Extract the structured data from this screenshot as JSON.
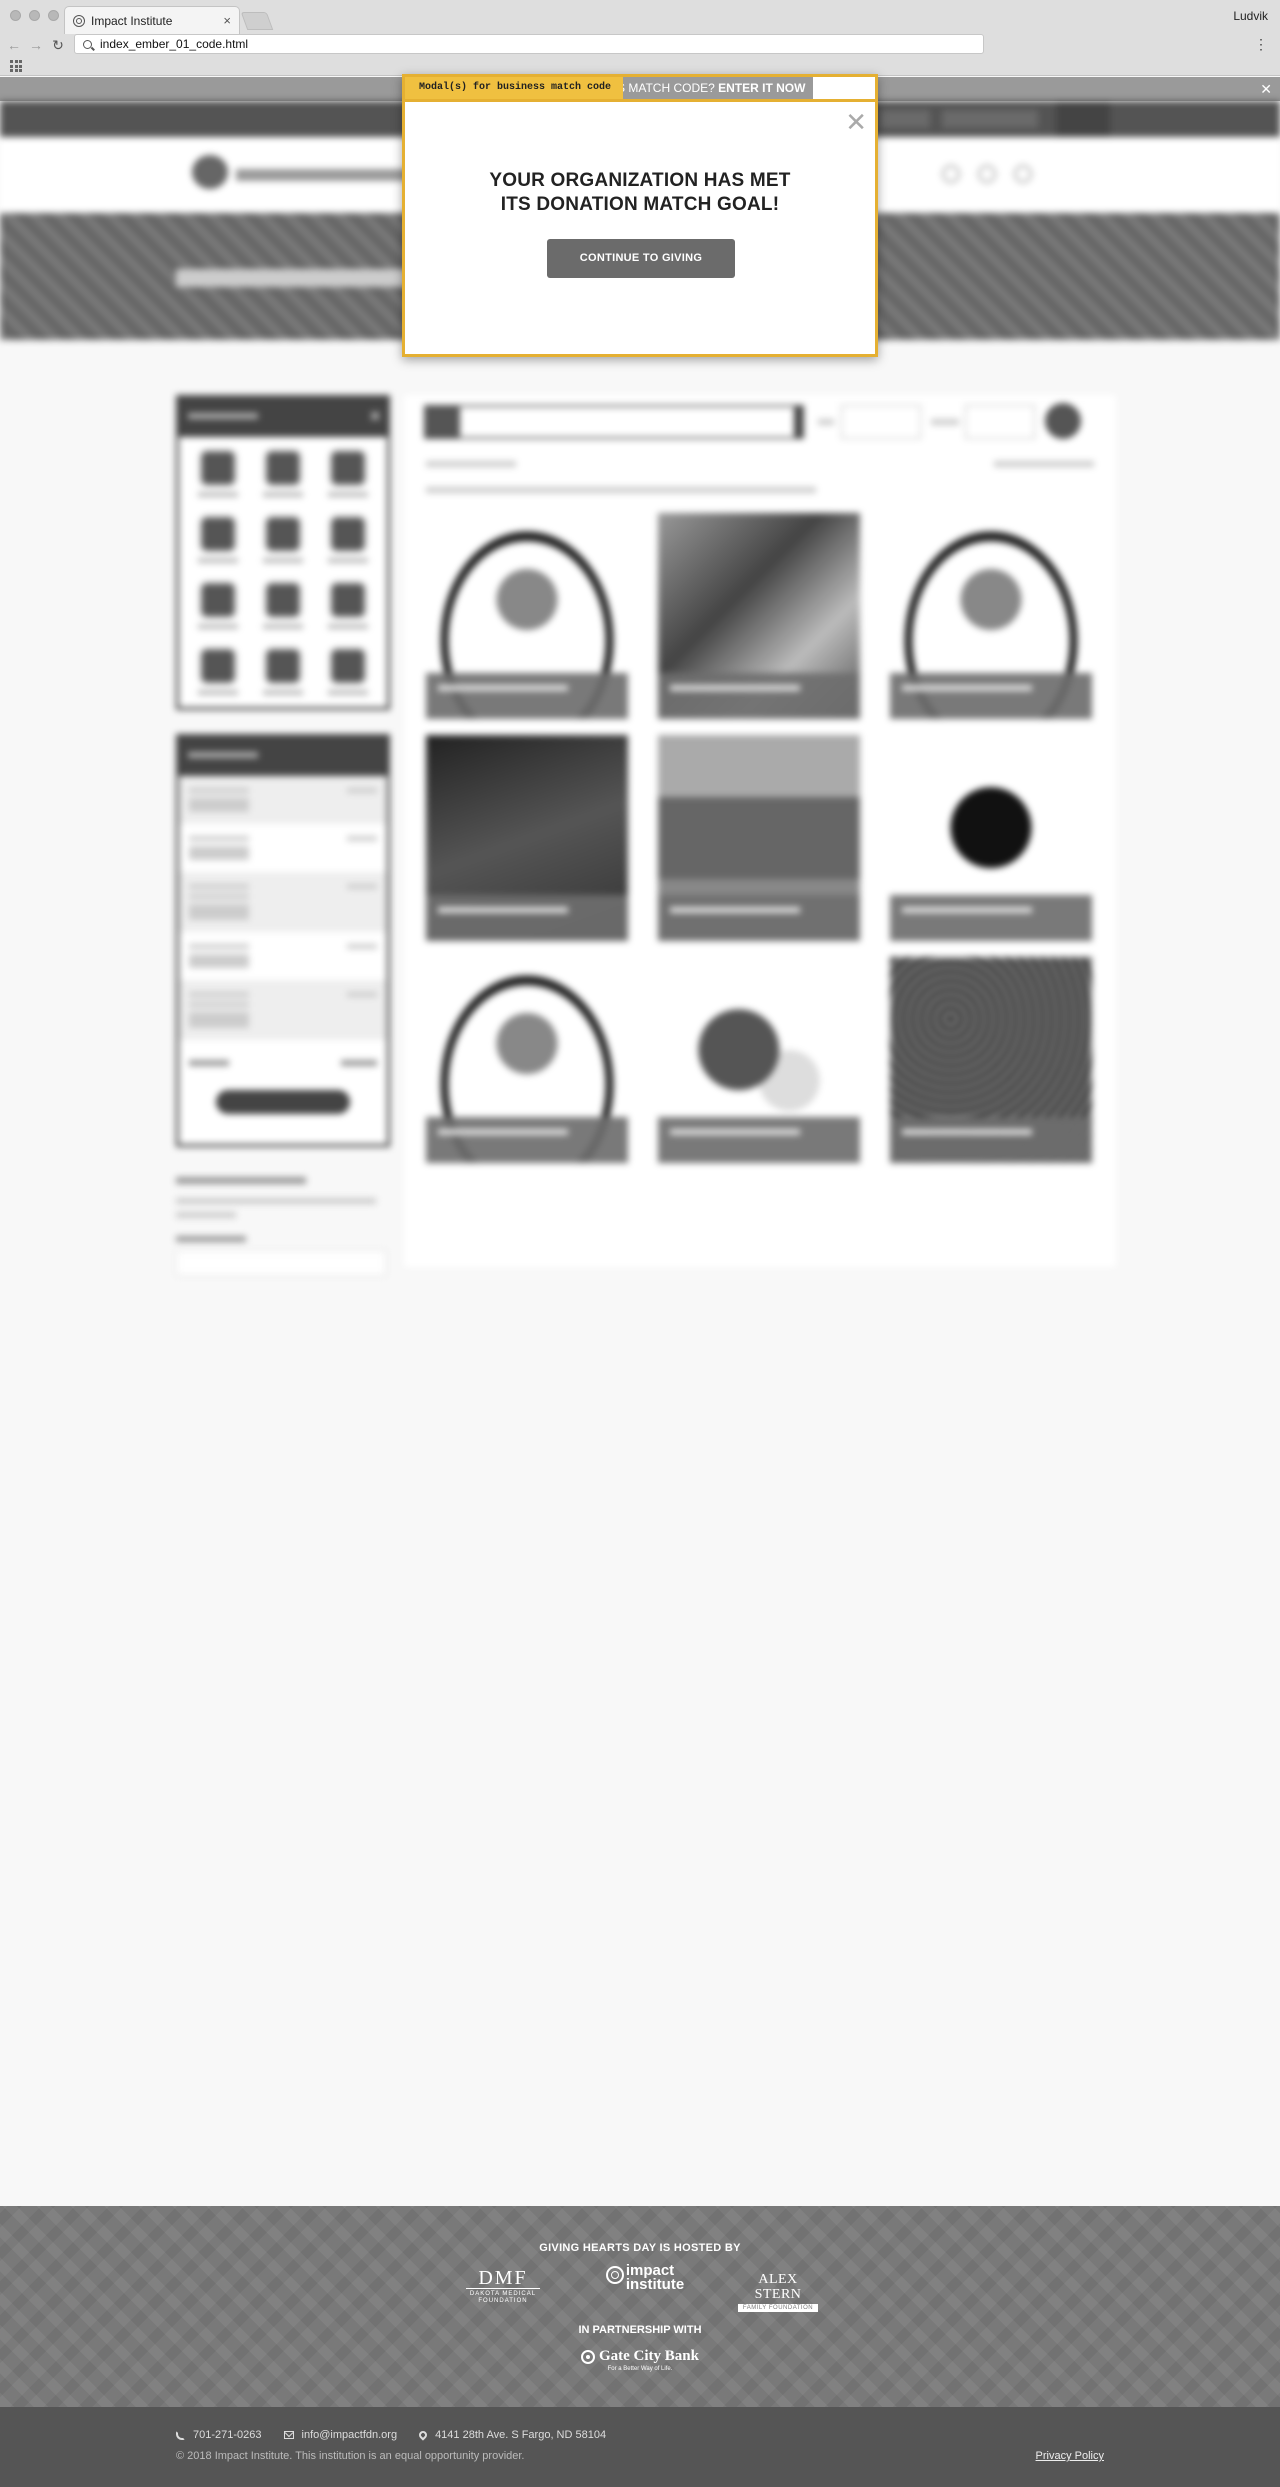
{
  "browser": {
    "tab_title": "Impact Institute",
    "tab_close": "×",
    "user": "Ludvik",
    "url": "index_ember_01_code.html",
    "back_glyph": "←",
    "forward_glyph": "→",
    "reload_glyph": "C",
    "menu_glyph": "⋮"
  },
  "banner": {
    "text_suffix": "S MATCH CODE? ",
    "cta": "ENTER IT NOW",
    "cta_icon": "➔",
    "close_glyph": "✕"
  },
  "modal": {
    "tag": "Modal(s) for business match code",
    "title_line1": "YOUR ORGANIZATION HAS MET",
    "title_line2": "ITS DONATION MATCH GOAL!",
    "button": "CONTINUE TO GIVING",
    "close_glyph": "✕"
  },
  "footer": {
    "hosted_by": "GIVING HEARTS DAY IS HOSTED BY",
    "sponsors": {
      "dmf_mark": "DMF",
      "dmf_sub": "DAKOTA MEDICAL FOUNDATION",
      "impact_line1": "impact",
      "impact_line2": "institute",
      "stern_mark": "ALEX STERN",
      "stern_sub": "FAMILY FOUNDATION"
    },
    "partnership": "IN PARTNERSHIP WITH",
    "gate_city_name": "Gate City Bank",
    "gate_city_tag": "For a Better Way of Life.",
    "phone": "701-271-0263",
    "email": "info@impactfdn.org",
    "address": "4141 28th Ave. S Fargo, ND 58104",
    "copyright": "© 2018 Impact Institute. This institution is an equal opportunity provider.",
    "privacy": "Privacy Policy"
  },
  "icons": {
    "tab_favicon": "impact-logo-icon",
    "phone": "phone-icon",
    "email": "envelope-icon",
    "address": "map-pin-icon",
    "apps": "apps-grid-icon"
  },
  "colors": {
    "modal_border": "#e5b032",
    "modal_tag": "#f0c040",
    "modal_button": "#6b6b6b",
    "footer_top": "#797979",
    "footer_bottom": "#555555"
  }
}
